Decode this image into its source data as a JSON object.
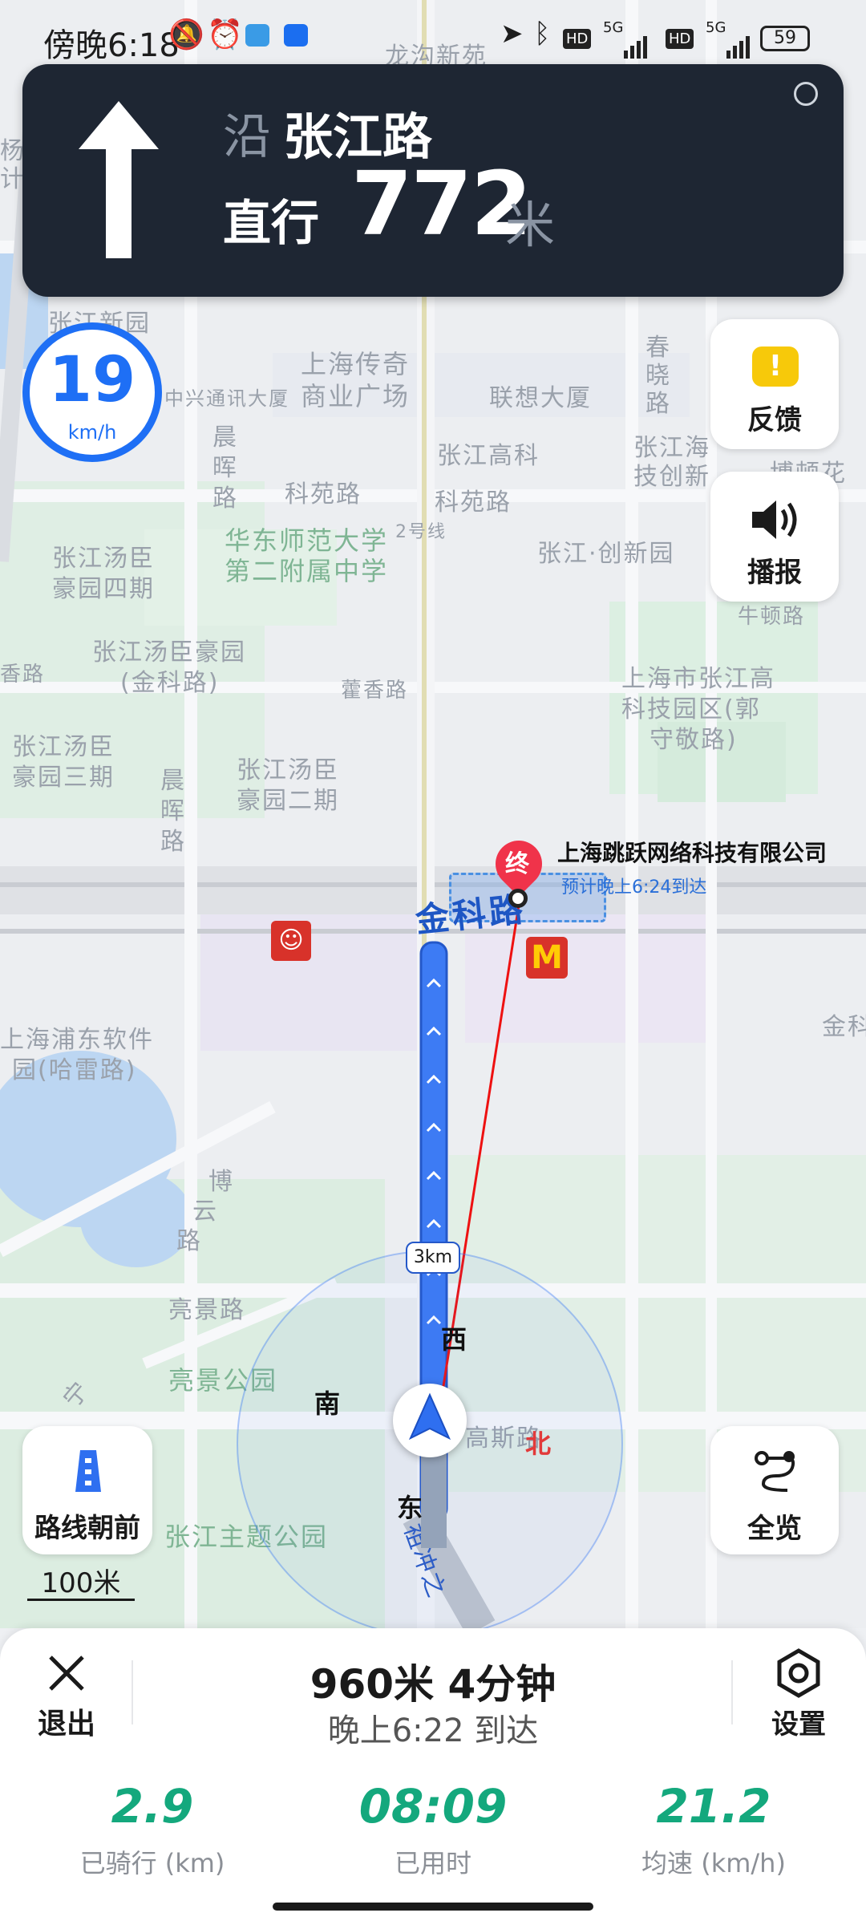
{
  "status_bar": {
    "time": "傍晚6:18",
    "battery": "59",
    "network_1": "5G",
    "network_2": "5G",
    "hd": "HD",
    "icons": [
      "bell-off-icon",
      "alarm-icon",
      "telegram-icon",
      "app-icon",
      "location-arrow-icon",
      "bluetooth-icon",
      "signal-icon",
      "battery-icon"
    ]
  },
  "nav_banner": {
    "road_prefix": "沿",
    "road_name": "张江路",
    "action": "直行",
    "distance": "772",
    "unit": "米",
    "direction_icon": "straight-arrow-icon"
  },
  "speed": {
    "value": "19",
    "unit": "km/h"
  },
  "side_buttons": {
    "feedback": "反馈",
    "broadcast": "播报",
    "route_ahead": "路线朝前",
    "overview": "全览"
  },
  "scale": "100米",
  "map": {
    "labels": [
      "龙沟新苑",
      "杨",
      "计",
      "张江新园",
      "上海传奇",
      "中兴通讯大厦",
      "商业广场",
      "联想大厦",
      "张江海",
      "技创新",
      "博顿花",
      "张江高科",
      "科苑路",
      "科苑路",
      "晨",
      "晖",
      "路",
      "春",
      "晓",
      "路",
      "华东师范大学",
      "第二附属中学",
      "2号线",
      "张江·创新园",
      "牛顿路",
      "张江汤臣",
      "豪园四期",
      "张江汤臣豪园",
      "(金科路)",
      "藿香路",
      "香路",
      "上海市张江高",
      "科技园区(郭",
      "守敬路)",
      "张江汤臣",
      "豪园三期",
      "张江汤臣",
      "豪园二期",
      "晨",
      "晖",
      "路",
      "上海浦东软件",
      "园(哈雷路)",
      "金科",
      "博",
      "云",
      "路",
      "亮景路",
      "亮景公园",
      "张江主题公园",
      "高斯路",
      "祖冲之",
      "宁"
    ],
    "destination_name": "上海跳跃网络科技有限公司",
    "destination_eta": "预计晚上6:24到达",
    "destination_marker": "终",
    "current_road": "金科路",
    "route_distance_badge": "3km",
    "compass": {
      "north": "北",
      "south": "南",
      "east": "东",
      "west": "西"
    }
  },
  "trip": {
    "remaining": "960米  4分钟",
    "arrival": "晚上6:22 到达",
    "exit": "退出",
    "settings": "设置",
    "stats": [
      {
        "value": "2.9",
        "label": "已骑行 (km)"
      },
      {
        "value": "08:09",
        "label": "已用时"
      },
      {
        "value": "21.2",
        "label": "均速 (km/h)"
      }
    ]
  },
  "colors": {
    "route": "#3d7bf4",
    "stat": "#14a87d",
    "banner": "#1e2633",
    "speed": "#1e6ff5"
  }
}
